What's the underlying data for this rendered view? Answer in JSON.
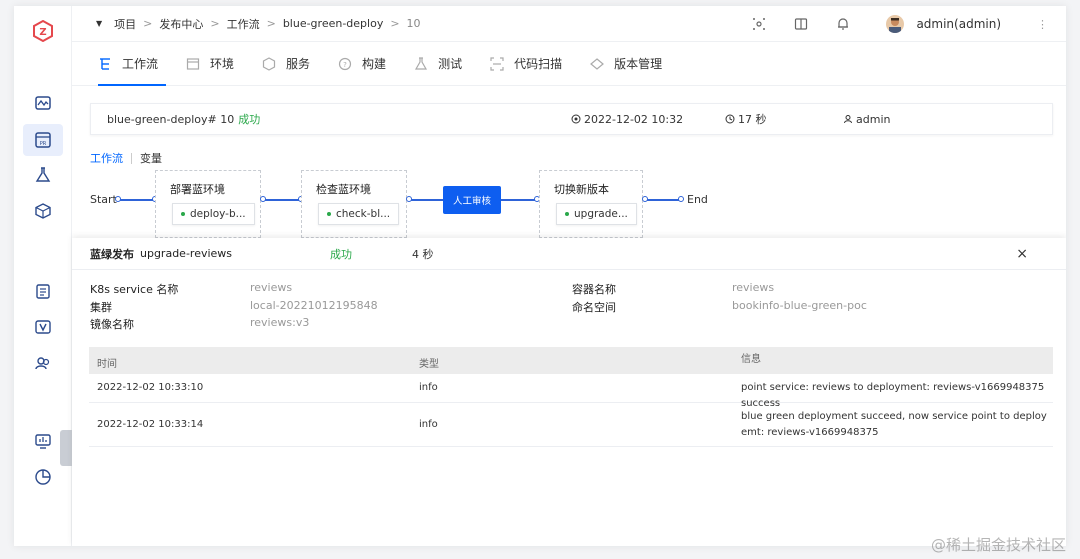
{
  "breadcrumb": {
    "items": [
      "项目",
      "发布中心",
      "工作流",
      "blue-green-deploy"
    ],
    "last": "10"
  },
  "header": {
    "user": "admin(admin)"
  },
  "tabs": [
    {
      "label": "工作流",
      "icon": "workflow-icon"
    },
    {
      "label": "环境",
      "icon": "environment-icon"
    },
    {
      "label": "服务",
      "icon": "service-icon"
    },
    {
      "label": "构建",
      "icon": "build-icon"
    },
    {
      "label": "测试",
      "icon": "test-icon"
    },
    {
      "label": "代码扫描",
      "icon": "code-scan-icon"
    },
    {
      "label": "版本管理",
      "icon": "version-icon"
    }
  ],
  "summary": {
    "workflow": "blue-green-deploy# 10",
    "status": "成功",
    "time": "2022-12-02 10:32",
    "duration": "17 秒",
    "user": "admin"
  },
  "subtabs": {
    "workflow": "工作流",
    "variables": "变量"
  },
  "pipeline": {
    "start": "Start",
    "end": "End",
    "stages": [
      {
        "name": "部署蓝环境",
        "job": "deploy-b..."
      },
      {
        "name": "检查蓝环境",
        "job": "check-bl..."
      },
      {
        "name": "切换新版本",
        "job": "upgrade..."
      }
    ],
    "approval": "人工审核"
  },
  "detail": {
    "title": "蓝绿发布",
    "name": "upgrade-reviews",
    "status": "成功",
    "duration": "4 秒",
    "close": "×",
    "fields": {
      "svc_key": "K8s service 名称",
      "svc_val": "reviews",
      "cluster_key": "集群",
      "cluster_val": "local-20221012195848",
      "image_key": "镜像名称",
      "image_val": "reviews:v3",
      "container_key": "容器名称",
      "container_val": "reviews",
      "ns_key": "命名空间",
      "ns_val": "bookinfo-blue-green-poc"
    },
    "table": {
      "headers": [
        "时间",
        "类型",
        "信息"
      ],
      "rows": [
        {
          "time": "2022-12-02 10:33:10",
          "type": "info",
          "msg": "point service: reviews to deployment: reviews-v1669948375 success"
        },
        {
          "time": "2022-12-02 10:33:14",
          "type": "info",
          "msg": "blue green deployment succeed, now service point to deployemt: reviews-v1669948375"
        }
      ]
    }
  },
  "watermark": "@稀土掘金技术社区",
  "colors": {
    "accent": "#0066ff",
    "success": "#2aa84a",
    "approve": "#0e5ef0"
  }
}
